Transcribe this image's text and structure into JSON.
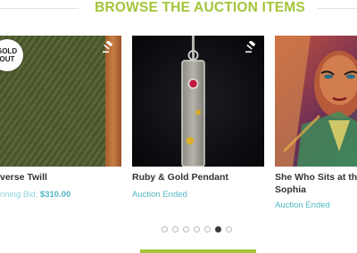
{
  "section": {
    "heading": "BROWSE THE AUCTION ITEMS"
  },
  "items": [
    {
      "title": "Converse Twill",
      "visible_title": "verse Twill",
      "status_prefix": "nning Bid: ",
      "status_amount": "$310.00",
      "badge": "SOLD\nOUT",
      "image": "green twill fabric"
    },
    {
      "title": "Ruby & Gold Pendant",
      "status": "Auction Ended",
      "image": "silver pendant with ruby"
    },
    {
      "title": "She Who Sits at the Sophia",
      "visible_title": "She Who Sits at the\nSophia",
      "status": "Auction Ended",
      "image": "colorful painted face"
    }
  ],
  "pagination": {
    "count": 7,
    "active_index": 5
  },
  "colors": {
    "accent_green": "#a3c53a",
    "status_teal": "#4fb8c3"
  },
  "icons": {
    "bid": "gavel-icon"
  }
}
